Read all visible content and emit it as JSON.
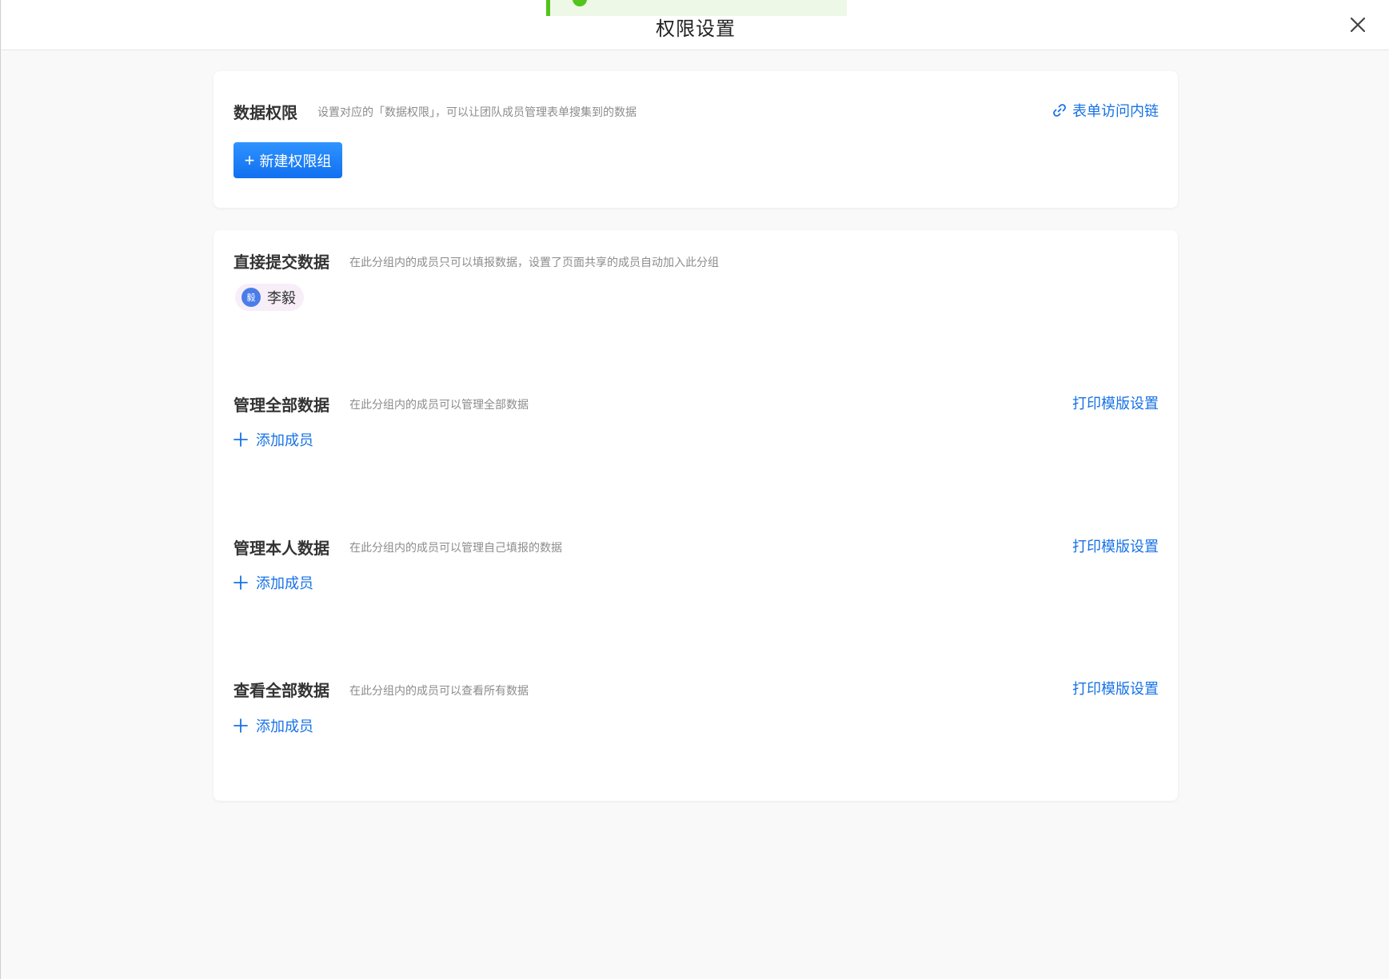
{
  "header": {
    "title": "权限设置",
    "close_icon": "close-icon"
  },
  "data_permission": {
    "title": "数据权限",
    "description": "设置对应的「数据权限」，可以让团队成员管理表单搜集到的数据",
    "link_label": "表单访问内链",
    "link_icon": "link-icon",
    "new_group_button": "新建权限组"
  },
  "groups": [
    {
      "title": "直接提交数据",
      "description": "在此分组内的成员只可以填报数据，设置了页面共享的成员自动加入此分组",
      "members": [
        {
          "avatar_text": "毅",
          "name": "李毅"
        }
      ]
    },
    {
      "title": "管理全部数据",
      "description": "在此分组内的成员可以管理全部数据",
      "right_link": "打印模版设置",
      "add_label": "添加成员"
    },
    {
      "title": "管理本人数据",
      "description": "在此分组内的成员可以管理自己填报的数据",
      "right_link": "打印模版设置",
      "add_label": "添加成员"
    },
    {
      "title": "查看全部数据",
      "description": "在此分组内的成员可以查看所有数据",
      "right_link": "打印模版设置",
      "add_label": "添加成员"
    }
  ],
  "colors": {
    "accent": "#1772e6",
    "primary_button": "#1170f0",
    "success": "#52c41a",
    "background": "#f9f9f9"
  }
}
